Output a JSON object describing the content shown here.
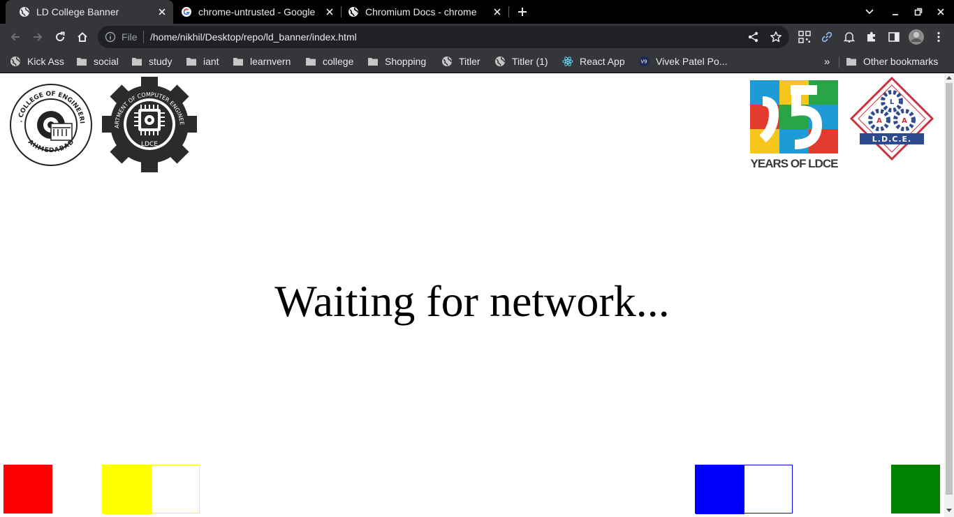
{
  "browser": {
    "tabs": [
      {
        "title": "LD College Banner",
        "active": true
      },
      {
        "title": "chrome-untrusted - Google",
        "active": false
      },
      {
        "title": "Chromium Docs - chrome",
        "active": false
      }
    ],
    "omnibox": {
      "scheme_label": "File",
      "url": "/home/nikhil/Desktop/repo/ld_banner/index.html"
    },
    "bookmarks": [
      {
        "label": "Kick Ass",
        "icon": "globe-icon"
      },
      {
        "label": "social",
        "icon": "folder-icon"
      },
      {
        "label": "study",
        "icon": "folder-icon"
      },
      {
        "label": "iant",
        "icon": "folder-icon"
      },
      {
        "label": "learnvern",
        "icon": "folder-icon"
      },
      {
        "label": "college",
        "icon": "folder-icon"
      },
      {
        "label": "Shopping",
        "icon": "folder-icon"
      },
      {
        "label": "Titler",
        "icon": "globe-icon"
      },
      {
        "label": "Titler (1)",
        "icon": "globe-icon"
      },
      {
        "label": "React App",
        "icon": "react-icon"
      },
      {
        "label": "Vivek Patel Po...",
        "icon": "v9-icon"
      }
    ],
    "bookmarks_overflow": "»",
    "other_bookmarks": "Other bookmarks"
  },
  "page": {
    "status_text": "Waiting for network...",
    "logos": {
      "ldce_seal": {
        "ring_text": "L.D. COLLEGE OF ENGINEERING",
        "bottom_text": "AHMEDABAD"
      },
      "computer_dept": {
        "ring_text": "DEPARTMENT OF COMPUTER ENGINEERING",
        "bottom_text": "LDCE"
      },
      "anniversary": {
        "number": "75",
        "caption": "YEARS OF LDCE"
      },
      "alumni": {
        "letters": [
          "L",
          "A",
          "A"
        ],
        "caption": "L.D.C.E."
      }
    },
    "colors": {
      "red": "#ff0000",
      "yellow": "#ffff00",
      "blue": "#0000ff",
      "green": "#008000"
    }
  }
}
